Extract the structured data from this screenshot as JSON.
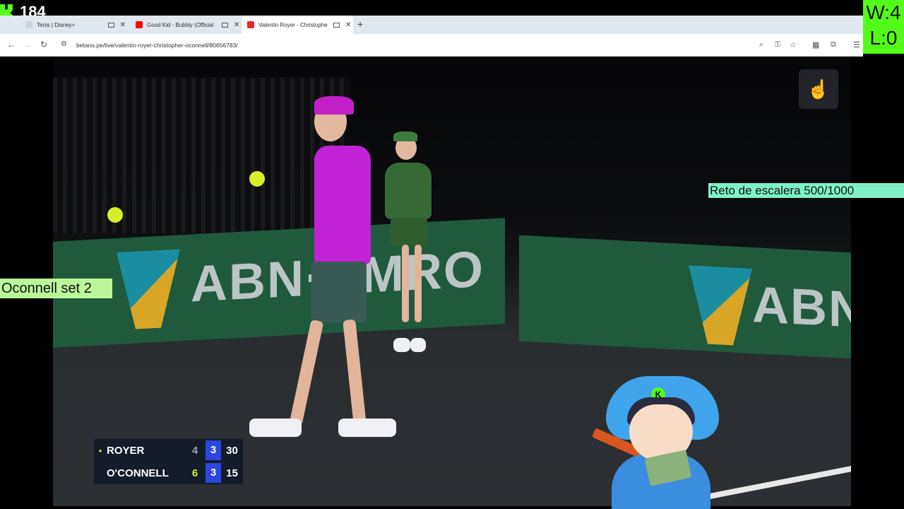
{
  "overlay": {
    "viewer_count": "184",
    "wins": "W:4",
    "losses": "L:0",
    "challenge_label": "Reto de escalera 500/1000",
    "bet_label": "Oconnell set 2",
    "hat_letter": "K"
  },
  "browser": {
    "tabs": [
      {
        "title": "Tenis | Disney+",
        "favicon_color": "#c9d4e0"
      },
      {
        "title": "Good Kid - Bubbly (Official",
        "favicon_color": "#ff0000"
      },
      {
        "title": "Valentin Royer - Christophe",
        "favicon_color": "#e3262f"
      }
    ],
    "new_tab": "+",
    "url": "betano.pe/live/valentin-royer-christopher-oconnell/80656783/"
  },
  "video": {
    "sponsor_text": "ABN·AMRO",
    "sponsor_text_2": "ABN"
  },
  "scoreboard": {
    "players": [
      {
        "name": "ROYER",
        "set1": "4",
        "set2": "3",
        "points": "30",
        "serving": true
      },
      {
        "name": "O'CONNELL",
        "set1": "6",
        "set2": "3",
        "points": "15",
        "serving": false
      }
    ]
  },
  "colors": {
    "kick_green": "#53fc18",
    "score_blue": "#2a45e0",
    "highlight_lime": "#c6f52c"
  }
}
